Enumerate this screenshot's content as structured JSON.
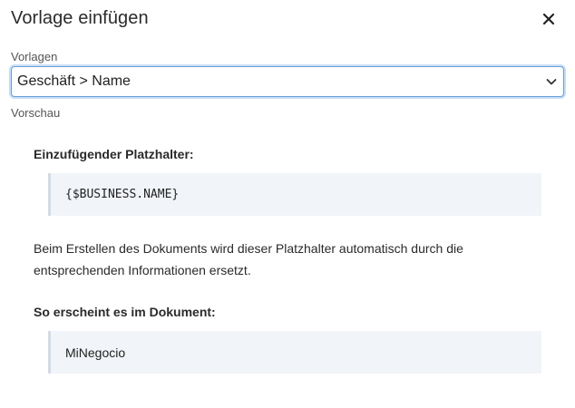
{
  "dialog": {
    "title": "Vorlage einfügen",
    "close_icon": "close-icon"
  },
  "templates": {
    "label": "Vorlagen",
    "selected": "Geschäft > Name",
    "chevron_icon": "chevron-down-icon"
  },
  "preview": {
    "label": "Vorschau",
    "placeholder_heading": "Einzufügender Platzhalter:",
    "placeholder_code": "{$BUSINESS.NAME}",
    "description": "Beim Erstellen des Dokuments wird dieser Platzhalter automatisch durch die entsprechenden Informationen ersetzt.",
    "result_heading": "So erscheint es im Dokument:",
    "result_value": "MiNegocio"
  },
  "colors": {
    "accent_border": "#6a9fd8",
    "block_background": "#f1f4f8",
    "block_rule": "#d3dbe5"
  }
}
